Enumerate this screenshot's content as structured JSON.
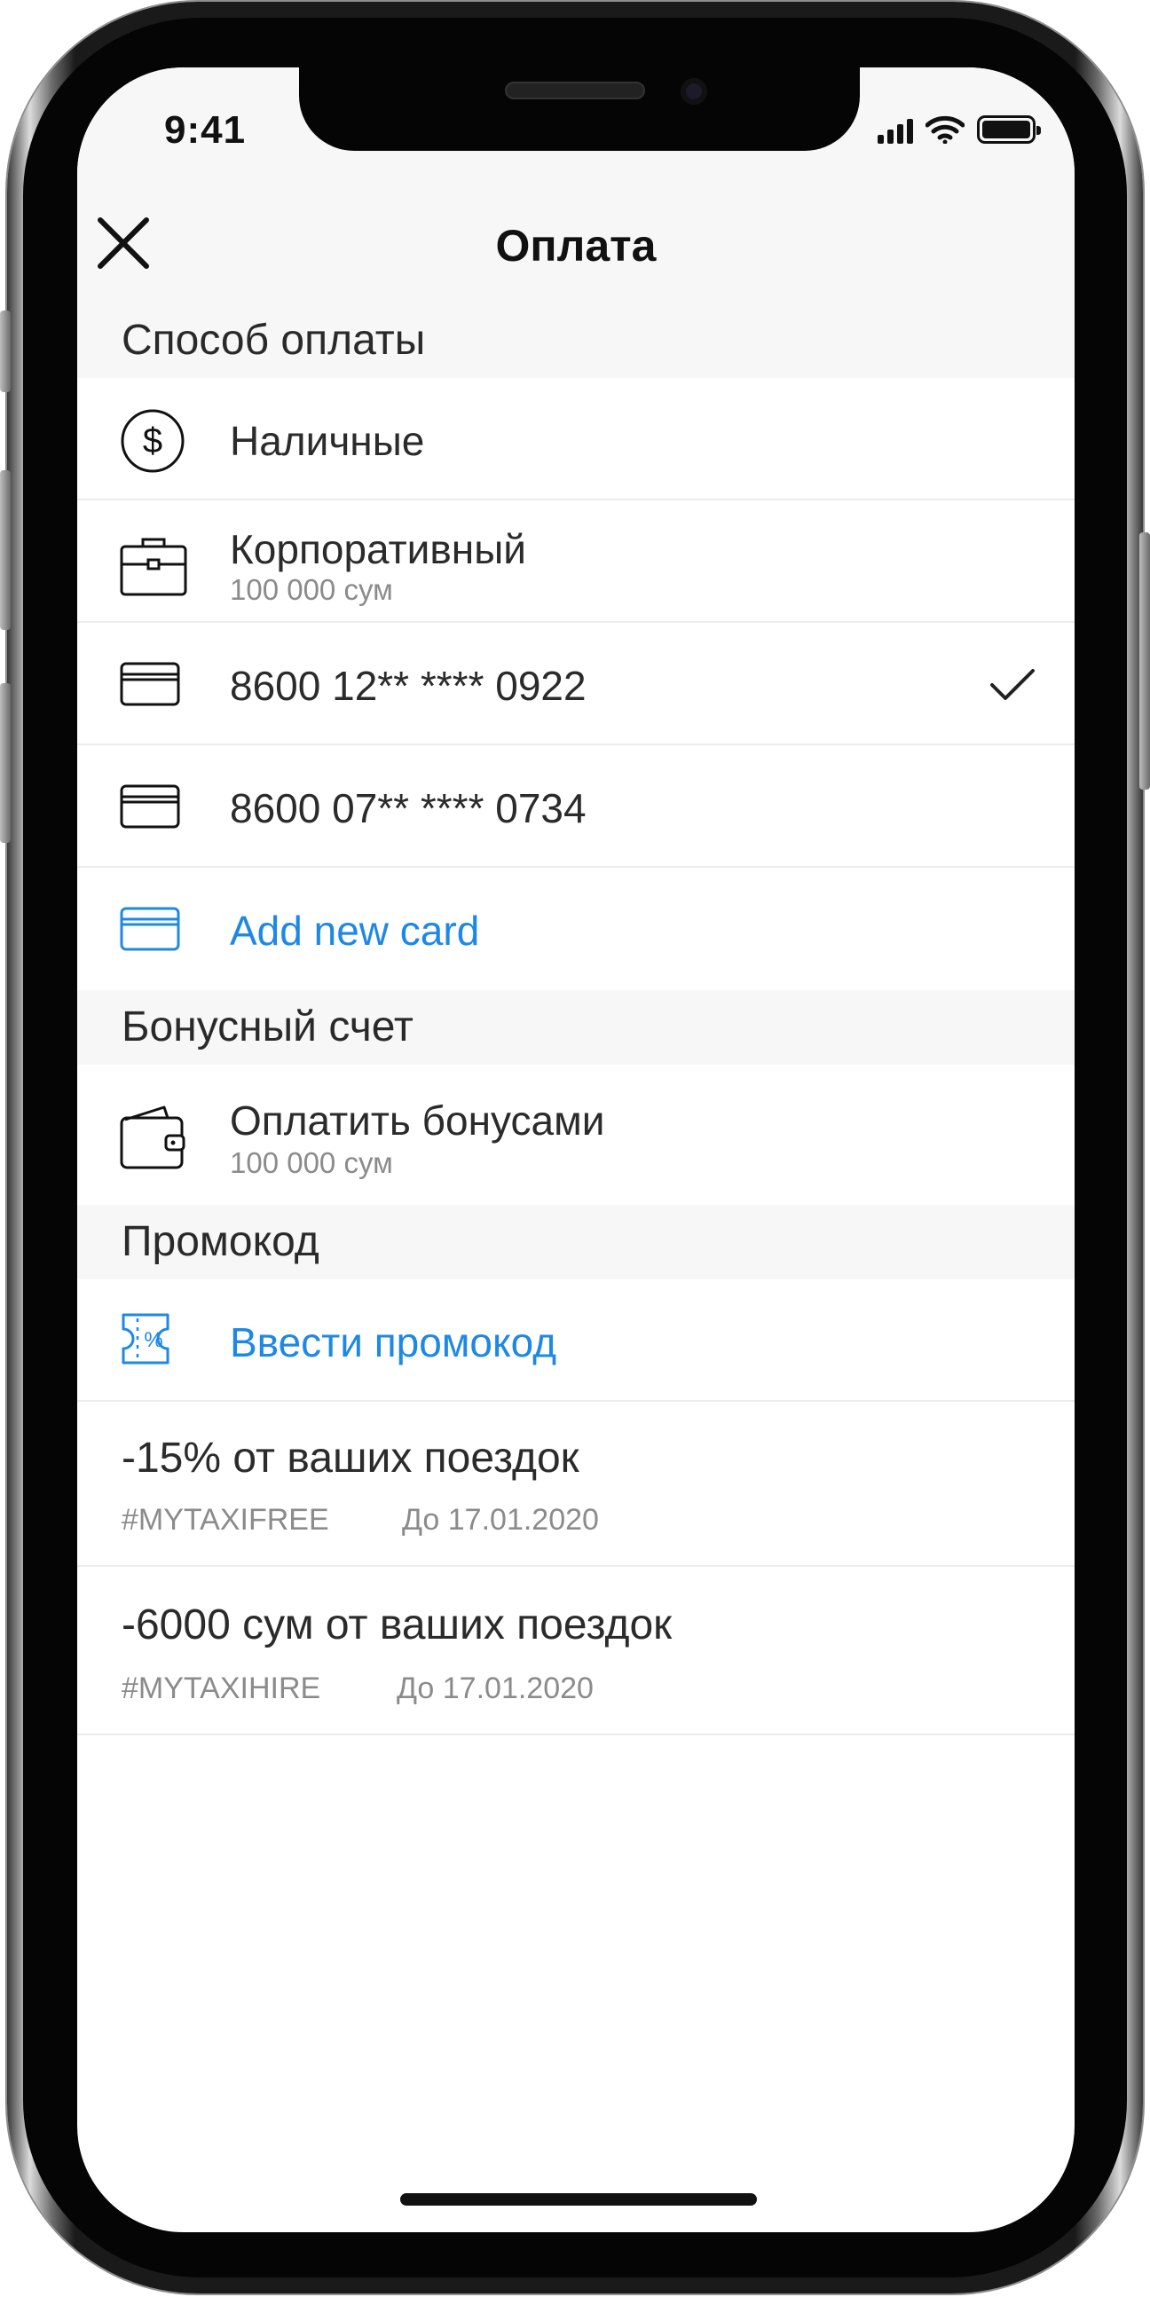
{
  "status_bar": {
    "time": "9:41"
  },
  "header": {
    "title": "Оплата"
  },
  "payment_methods": {
    "section_title": "Способ оплаты",
    "items": [
      {
        "label": "Наличные",
        "icon": "dollar-circle-icon"
      },
      {
        "label": "Корпоративный",
        "sub": "100 000 сум",
        "icon": "briefcase-icon"
      },
      {
        "label": "8600 12** **** 0922",
        "icon": "card-icon",
        "selected": true
      },
      {
        "label": "8600 07** **** 0734",
        "icon": "card-icon"
      }
    ],
    "add_card_label": "Add new card"
  },
  "bonus": {
    "section_title": "Бонусный счет",
    "label": "Оплатить бонусами",
    "sub": "100 000 сум"
  },
  "promo": {
    "section_title": "Промокод",
    "enter_label": "Ввести промокод",
    "items": [
      {
        "title": "-15% от ваших поездок",
        "code": "#MYTAXIFREE",
        "valid_until": "До 17.01.2020"
      },
      {
        "title": "-6000 сум от ваших поездок",
        "code": "#MYTAXIHIRE",
        "valid_until": "До 17.01.2020"
      }
    ]
  },
  "colors": {
    "accent": "#1e88e5",
    "section_bg": "#f7f7f7",
    "text": "#2b2b2b",
    "muted": "#8b8b8b"
  }
}
